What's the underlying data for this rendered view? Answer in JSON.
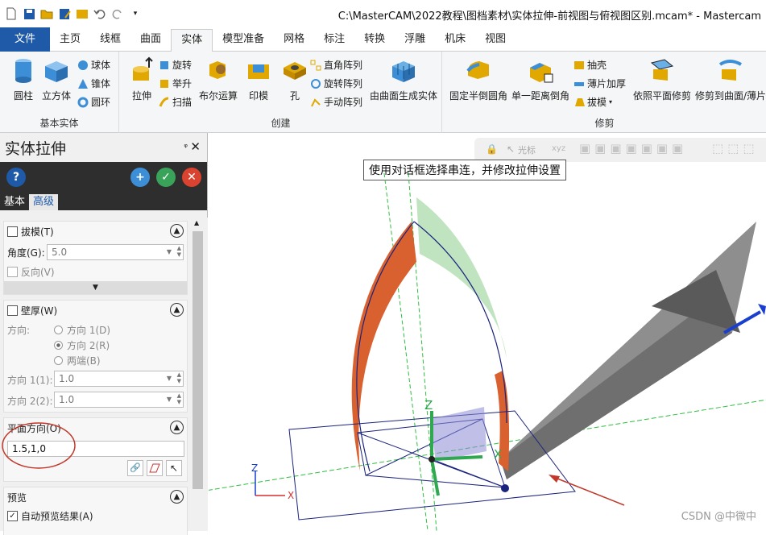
{
  "title_bar": {
    "title": "C:\\MasterCAM\\2022教程\\图档素材\\实体拉伸-前视图与俯视图区别.mcam* - Mastercam"
  },
  "quick_access": [
    "new-file-icon",
    "save-icon",
    "open-icon",
    "save-as-icon",
    "folder-icon",
    "undo-icon",
    "redo-icon",
    "customize-icon"
  ],
  "tabs": [
    "文件",
    "主页",
    "线框",
    "曲面",
    "实体",
    "模型准备",
    "网格",
    "标注",
    "转换",
    "浮雕",
    "机床",
    "视图"
  ],
  "active_tab": "实体",
  "ribbon": {
    "basic_solids": {
      "label": "基本实体",
      "cylinder": "圆柱",
      "box": "立方体",
      "sphere": "球体",
      "cone": "锥体",
      "torus": "圆环"
    },
    "create": {
      "label": "创建",
      "extrude": "拉伸",
      "revolve": "旋转",
      "loft": "举升",
      "sweep": "扫描",
      "boolean": "布尔运算",
      "impression": "印模",
      "hole": "孔",
      "rect_array": "直角阵列",
      "rot_array": "旋转阵列",
      "manual_array": "手动阵列",
      "from_surfaces": "由曲面生成实体"
    },
    "modify": {
      "label": "修剪",
      "fillet": "固定半倒圆角",
      "chamfer": "单一距离倒角",
      "shell": "抽壳",
      "thicken": "薄片加厚",
      "draft": "拔模",
      "trim_plane": "依照平面修剪",
      "trim_surface": "修剪到曲面/薄片"
    }
  },
  "panel": {
    "title": "实体拉伸",
    "tab_basic": "基本",
    "tab_advanced": "高级",
    "draft": {
      "label": "拔模(T)",
      "angle_label": "角度(G):",
      "angle_value": "5.0",
      "reverse_label": "反向(V)"
    },
    "wall": {
      "label": "壁厚(W)",
      "direction_label": "方向:",
      "dir1": "方向 1(D)",
      "dir2": "方向 2(R)",
      "both": "两端(B)",
      "dir1_thick_label": "方向 1(1):",
      "dir1_thick_value": "1.0",
      "dir2_thick_label": "方向 2(2):",
      "dir2_thick_value": "1.0"
    },
    "plane_direction": {
      "label": "平面方向(O)",
      "value": "1.5,1,0"
    },
    "preview": {
      "label": "预览",
      "auto_preview": "自动预览结果(A)"
    }
  },
  "viewport": {
    "tooltip": "使用对话框选择串连，并修改拉伸设置",
    "toolbar_cursor": "光标",
    "axis_z": "Z",
    "axis_x": "X",
    "gnomon_x": "X",
    "gnomon_z": "Z",
    "watermark": "CSDN @中微中"
  }
}
